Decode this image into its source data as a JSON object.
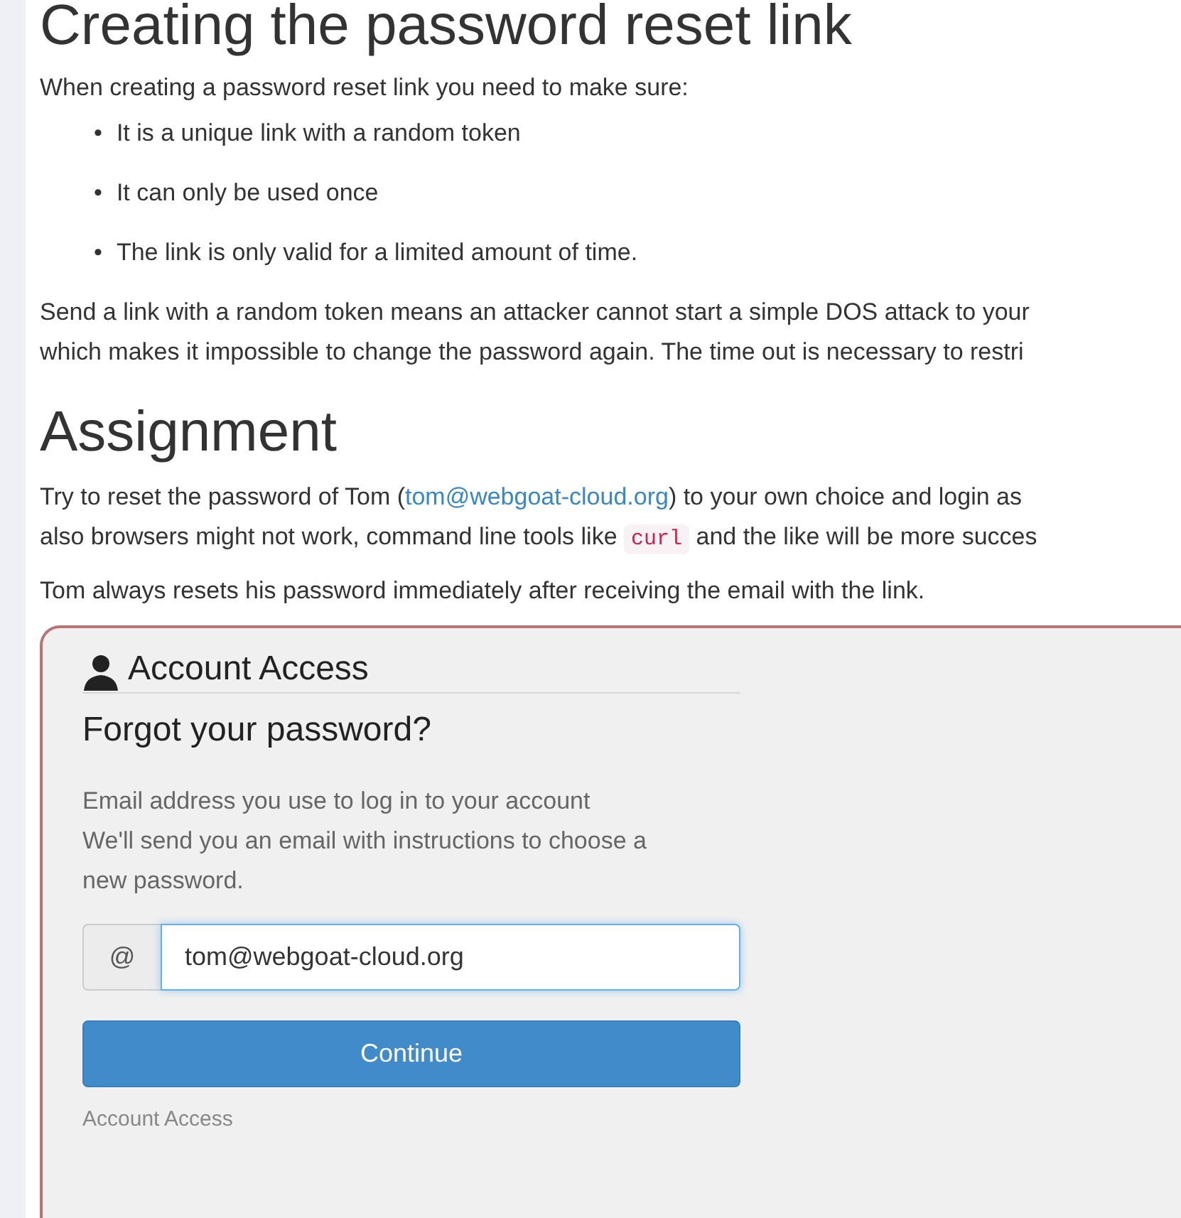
{
  "heading_cut": "Creating the password reset link",
  "intro": "When creating a password reset link you need to make sure:",
  "bullets": [
    {
      "marker": "•",
      "text": "It is a unique link with a random token"
    },
    {
      "marker": "•",
      "text": "It can only be used once"
    },
    {
      "marker": "•",
      "text": "The link is only valid for a limited amount of time."
    }
  ],
  "explanation": [
    "Send a link with a random token means an attacker cannot start a simple DOS attack to your",
    "which makes it impossible to change the password again. The time out is necessary to restri"
  ],
  "assignment": {
    "title": "Assignment",
    "lines": [
      [
        {
          "kind": "text",
          "text": "Try to reset the password of Tom ("
        },
        {
          "kind": "link",
          "text": "tom@webgoat-cloud.org"
        },
        {
          "kind": "text",
          "text": ") to your own choice and login as"
        }
      ],
      [
        {
          "kind": "text",
          "text": "also browsers might not work, command line tools like "
        },
        {
          "kind": "code",
          "text": "curl"
        },
        {
          "kind": "text",
          "text": " and the like will be more succes"
        }
      ]
    ],
    "note": "Tom always resets his password immediately after receiving the email with the link."
  },
  "form": {
    "title": "Account Access",
    "subtitle": "Forgot your password?",
    "help": [
      "Email address you use to log in to your account",
      "We'll send you an email with instructions to choose a",
      "new password."
    ],
    "addon": "@",
    "email_value": "tom@webgoat-cloud.org",
    "focused": true,
    "button": "Continue",
    "footer": "Account Access"
  }
}
